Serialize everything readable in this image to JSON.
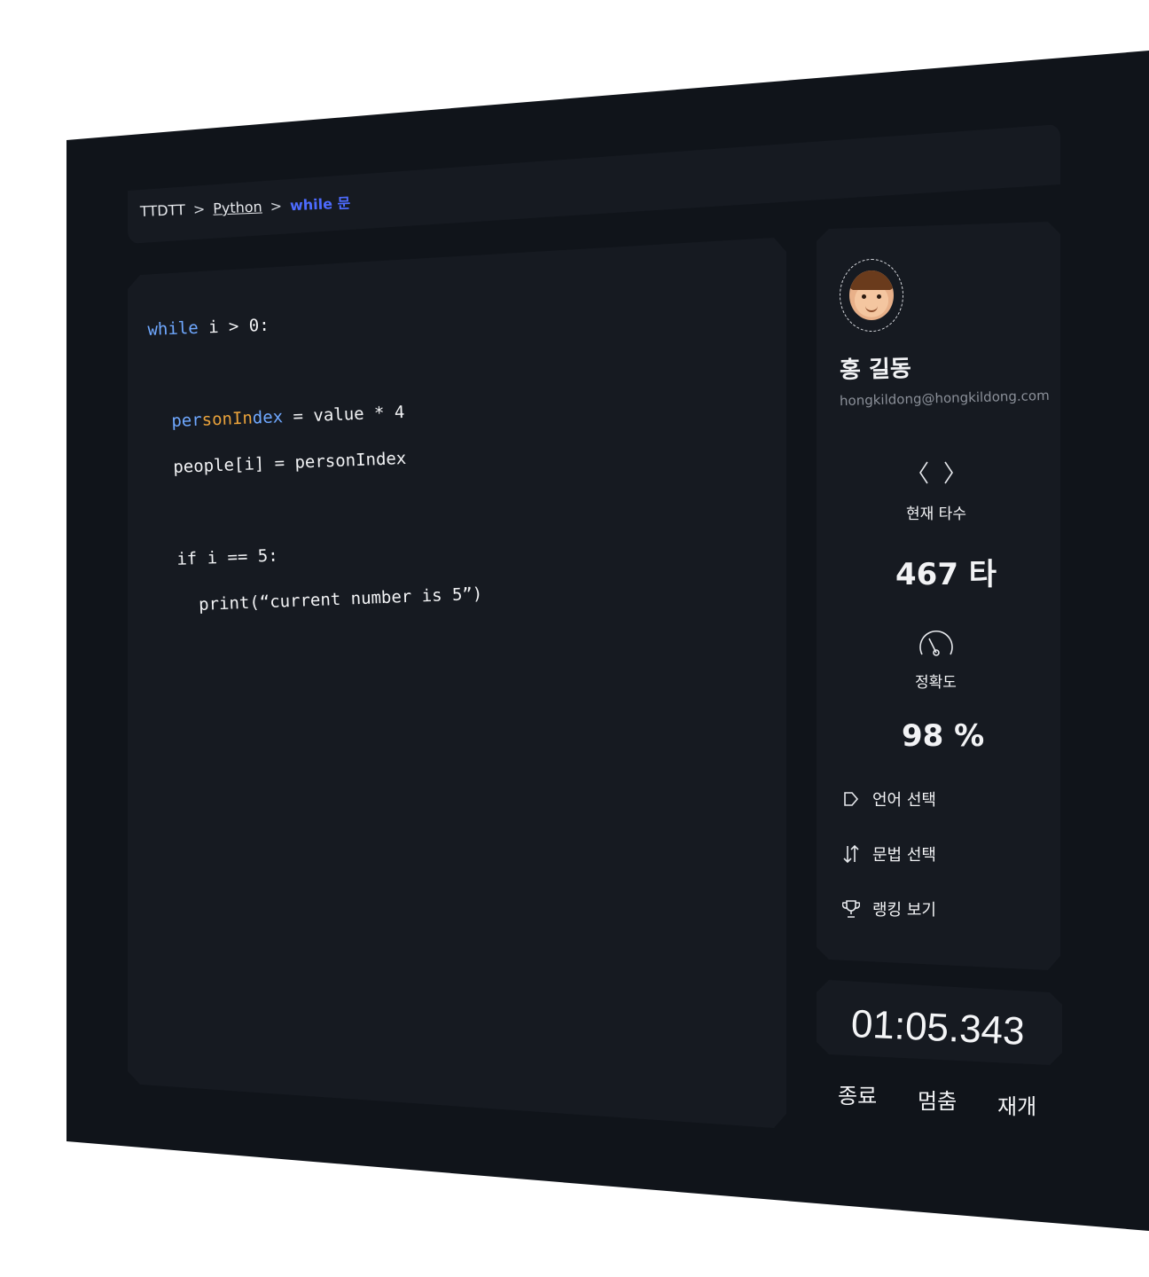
{
  "breadcrumb": {
    "root": "TTDTT",
    "sep1": ">",
    "section": "Python",
    "sep2": ">",
    "current": "while 문"
  },
  "code": {
    "line1_kw": "while",
    "line1_rest": " i > 0:",
    "line2_a": "per",
    "line2_b": "sonIn",
    "line2_c": "dex",
    "line2_rest": " = value * 4",
    "line3": "people[i] = personIndex",
    "line4": "if i == 5:",
    "line5": "print(“current number is 5”)"
  },
  "profile": {
    "name": "홍 길동",
    "email": "hongkildong@hongkildong.com",
    "avatar_icon": "memoji-avatar"
  },
  "stats": {
    "speed_label": "현재 타수",
    "speed_value": "467 타",
    "speed_icon": "code-brackets-icon",
    "accuracy_label": "정확도",
    "accuracy_value": "98 %",
    "accuracy_icon": "speedometer-icon"
  },
  "menu": [
    {
      "label": "언어 선택",
      "icon": "tag-icon"
    },
    {
      "label": "문법 선택",
      "icon": "sort-arrows-icon"
    },
    {
      "label": "랭킹 보기",
      "icon": "trophy-icon"
    }
  ],
  "timer": {
    "value": "01:05.343",
    "end_label": "종료",
    "pause_label": "멈춤",
    "resume_label": "재개"
  },
  "colors": {
    "background": "#10141a",
    "panel": "#161a21",
    "accent": "#4d6bff",
    "keyword": "#6fa8ff",
    "highlight": "#e9a23b"
  }
}
